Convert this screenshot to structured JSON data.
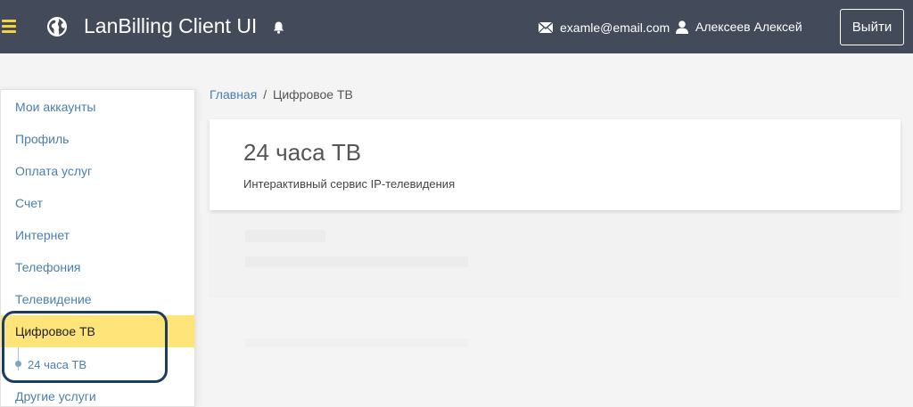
{
  "header": {
    "title": "LanBilling Client UI",
    "email": "examle@email.com",
    "user_name": "Алексеев Алексей",
    "logout_label": "Выйти"
  },
  "sidebar": {
    "items": [
      {
        "label": "Мои аккаунты"
      },
      {
        "label": "Профиль"
      },
      {
        "label": "Оплата услуг"
      },
      {
        "label": "Счет"
      },
      {
        "label": "Интернет"
      },
      {
        "label": "Телефония"
      },
      {
        "label": "Телевидение"
      },
      {
        "label": "Цифровое ТВ"
      },
      {
        "label": "Другие услуги"
      }
    ],
    "sub_items": [
      {
        "label": "24 часа ТВ"
      }
    ]
  },
  "breadcrumb": {
    "home": "Главная",
    "separator": "/",
    "current": "Цифровое ТВ"
  },
  "card": {
    "title": "24 часа ТВ",
    "description": "Интерактивный сервис IP-телевидения"
  },
  "colors": {
    "header_bg": "#434a5a",
    "accent_yellow": "#ffe47a",
    "hamburger": "#f5d33e",
    "link": "#4a7fb0",
    "highlight_ring": "#1c3d5e"
  },
  "icons": [
    "hamburger-icon",
    "globe-icon",
    "bell-icon",
    "envelope-icon",
    "user-icon"
  ]
}
